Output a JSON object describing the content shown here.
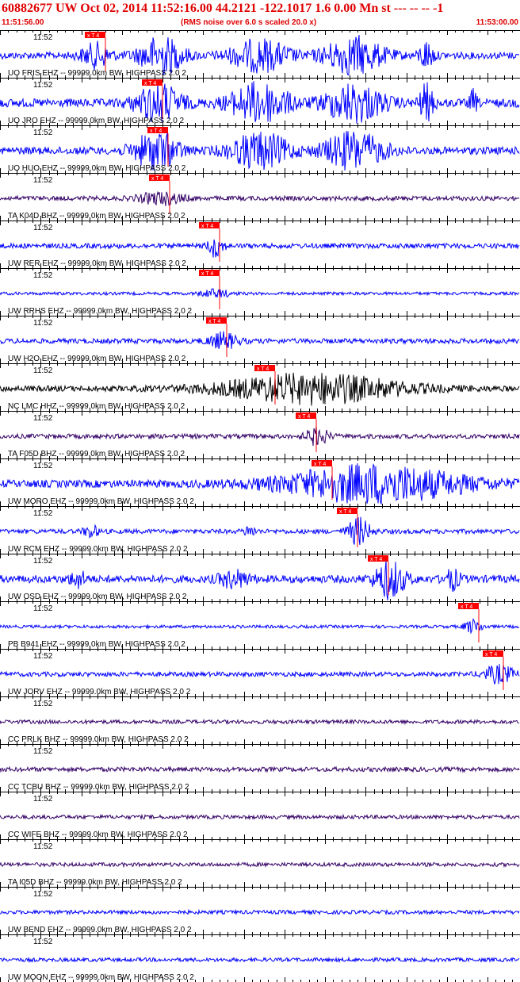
{
  "header": {
    "title": "60882677 UW Oct 02, 2014 11:52:16.00   44.2121 -122.1017  1.6 0.00 Mn st --- -- --  -1",
    "start_time": "11:51:56.00",
    "note": "(RMS noise over 6.0 s scaled 20.0 x)",
    "end_time": "11:53:00.00"
  },
  "chart_data": {
    "type": "line",
    "title": "60882677 UW Oct 02, 2014 11:52:16.00   44.2121 -122.1017  1.6 0.00 Mn st --- -- --  -1",
    "x_range": [
      "11:51:56.00",
      "11:53:00.00"
    ],
    "tick_label": "11:52",
    "phase_label": "x T 4",
    "colors": {
      "text": "#e00000",
      "marker": "#ff0000",
      "blue": "#0000ff",
      "purple": "#330066",
      "black": "#000000"
    },
    "series": [
      {
        "name": "UO FRIS EHZ -- 99999.0km BW, HIGHPASS  2.0  2",
        "color": "#0000ff",
        "pick": 0.163,
        "noise": 0.18,
        "bursts": [
          [
            0.185,
            0.02,
            0.6
          ],
          [
            0.31,
            0.03,
            0.95
          ],
          [
            0.5,
            0.04,
            0.8
          ],
          [
            0.68,
            0.04,
            0.95
          ],
          [
            0.82,
            0.01,
            0.7
          ]
        ]
      },
      {
        "name": "UO JRO EHZ -- 99999.0km BW, HIGHPASS  2.0  2",
        "color": "#0000ff",
        "pick": 0.273,
        "noise": 0.22,
        "bursts": [
          [
            0.305,
            0.03,
            0.95
          ],
          [
            0.5,
            0.04,
            1.0
          ],
          [
            0.68,
            0.04,
            0.95
          ],
          [
            0.82,
            0.01,
            0.9
          ],
          [
            0.91,
            0.005,
            0.6
          ]
        ]
      },
      {
        "name": "UO HUO EHZ -- 99999.0km BW, HIGHPASS  2.0  2",
        "color": "#0000ff",
        "pick": 0.283,
        "noise": 0.2,
        "bursts": [
          [
            0.3,
            0.03,
            0.95
          ],
          [
            0.5,
            0.04,
            0.9
          ],
          [
            0.68,
            0.04,
            0.95
          ]
        ]
      },
      {
        "name": "TA K04D BHZ -- 99999.0km BW, HIGHPASS  2.0  2",
        "color": "#330066",
        "pick": 0.287,
        "noise": 0.12,
        "bursts": [
          [
            0.31,
            0.03,
            0.3
          ]
        ]
      },
      {
        "name": "UW RER EHZ -- 99999.0km BW, HIGHPASS  2.0  2",
        "color": "#0000ff",
        "pick": 0.382,
        "noise": 0.13,
        "bursts": [
          [
            0.415,
            0.01,
            0.55
          ]
        ]
      },
      {
        "name": "UW RRHS EHZ -- 99999.0km BW, HIGHPASS  2.0  2",
        "color": "#0000ff",
        "pick": 0.382,
        "noise": 0.08,
        "bursts": [
          [
            0.415,
            0.02,
            0.2
          ]
        ]
      },
      {
        "name": "UW H2O EHZ -- 99999.0km BW, HIGHPASS  2.0  2",
        "color": "#0000ff",
        "pick": 0.397,
        "noise": 0.13,
        "bursts": [
          [
            0.43,
            0.02,
            0.4
          ]
        ]
      },
      {
        "name": "NC LMC HHZ -- 99999.0km BW, HIGHPASS  2.0  2",
        "color": "#000000",
        "pick": 0.49,
        "noise": 0.15,
        "bursts": [
          [
            0.6,
            0.12,
            0.75
          ]
        ]
      },
      {
        "name": "TA F05D BHZ -- 99999.0km BW, HIGHPASS  2.0  2",
        "color": "#330066",
        "pick": 0.568,
        "noise": 0.12,
        "bursts": [
          [
            0.61,
            0.015,
            0.45
          ]
        ]
      },
      {
        "name": "UW MORO EHZ -- 99999.0km BW, HIGHPASS  2.0  2",
        "color": "#0000ff",
        "pick": 0.599,
        "noise": 0.2,
        "bursts": [
          [
            0.72,
            0.12,
            0.95
          ]
        ]
      },
      {
        "name": "UW RCM EHZ -- 99999.0km BW, HIGHPASS  2.0  2",
        "color": "#0000ff",
        "pick": 0.648,
        "noise": 0.12,
        "bursts": [
          [
            0.175,
            0.01,
            0.3
          ],
          [
            0.48,
            0.008,
            0.25
          ],
          [
            0.69,
            0.015,
            0.7
          ]
        ]
      },
      {
        "name": "UW OSD EHZ -- 99999.0km BW, HIGHPASS  2.0  2",
        "color": "#0000ff",
        "pick": 0.708,
        "noise": 0.2,
        "bursts": [
          [
            0.15,
            0.01,
            0.4
          ],
          [
            0.45,
            0.02,
            0.4
          ],
          [
            0.75,
            0.02,
            0.95
          ],
          [
            0.87,
            0.01,
            0.5
          ]
        ]
      },
      {
        "name": "PB B941 EHZ -- 99999.0km BW, HIGHPASS  2.0  2",
        "color": "#0000ff",
        "pick": 0.881,
        "noise": 0.08,
        "bursts": [
          [
            0.91,
            0.012,
            0.35
          ]
        ]
      },
      {
        "name": "UW JORV EHZ -- 99999.0km BW, HIGHPASS  2.0  2",
        "color": "#0000ff",
        "pick": 0.928,
        "noise": 0.12,
        "bursts": [
          [
            0.96,
            0.02,
            0.45
          ]
        ]
      },
      {
        "name": "CC PRLK BHZ -- 99999.0km BW, HIGHPASS  2.0  2",
        "color": "#330066",
        "pick": null,
        "noise": 0.1,
        "bursts": []
      },
      {
        "name": "CC TCBU BHZ -- 99999.0km BW, HIGHPASS  2.0  2",
        "color": "#330066",
        "pick": null,
        "noise": 0.12,
        "bursts": []
      },
      {
        "name": "CC WIFE BHZ -- 99999.0km BW, HIGHPASS  2.0  2",
        "color": "#330066",
        "pick": null,
        "noise": 0.1,
        "bursts": []
      },
      {
        "name": "TA I05D BHZ -- 99999.0km BW, HIGHPASS  2.0  2",
        "color": "#330066",
        "pick": null,
        "noise": 0.1,
        "bursts": []
      },
      {
        "name": "UW BEND EHZ -- 99999.0km BW, HIGHPASS  2.0  2",
        "color": "#0000ff",
        "pick": null,
        "noise": 0.1,
        "bursts": []
      },
      {
        "name": "UW MOON EHZ -- 99999.0km BW, HIGHPASS  2.0  2",
        "color": "#0000ff",
        "pick": null,
        "noise": 0.1,
        "bursts": []
      }
    ]
  }
}
